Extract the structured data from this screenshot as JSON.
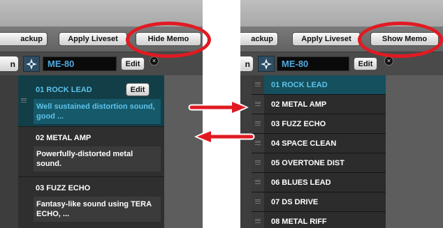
{
  "left_panel": {
    "backup_label": "ackup",
    "apply_liveset_label": "Apply Liveset",
    "memo_toggle_label": "Hide Memo",
    "stub_label": "n",
    "device_name": "ME-80",
    "edit_label": "Edit",
    "close_symbol": "×",
    "items": [
      {
        "name": "01  ROCK LEAD",
        "memo": "Well sustained distortion sound, good ...",
        "edit_label": "Edit"
      },
      {
        "name": "02  METAL AMP",
        "memo": "Powerfully-distorted metal sound."
      },
      {
        "name": "03  FUZZ ECHO",
        "memo": "Fantasy-like sound using TERA ECHO, ..."
      }
    ]
  },
  "right_panel": {
    "backup_label": "ackup",
    "apply_liveset_label": "Apply Liveset",
    "memo_toggle_label": "Show Memo",
    "stub_label": "n",
    "device_name": "ME-80",
    "edit_label": "Edit",
    "close_symbol": "×",
    "items": [
      "01  ROCK LEAD",
      "02  METAL AMP",
      "03  FUZZ ECHO",
      "04  SPACE CLEAN",
      "05  OVERTONE DIST",
      "06  BLUES LEAD",
      "07  DS DRIVE",
      "08  METAL RIFF"
    ]
  },
  "colors": {
    "highlight": "#e11a22",
    "selected_text": "#5ec3ea",
    "selected_bg": "#14505e"
  },
  "icons": [
    "device-logo-icon",
    "close-icon",
    "drag-handle-icon",
    "arrow-right-icon",
    "arrow-left-icon"
  ]
}
